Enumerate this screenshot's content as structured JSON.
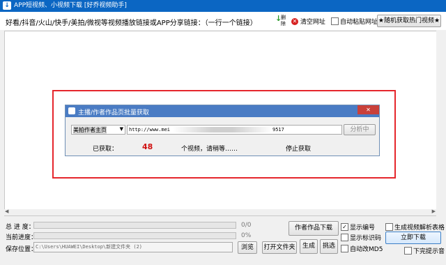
{
  "window": {
    "title": "APP短视频、小视频下载 [好乔视频助手]"
  },
  "top": {
    "prompt": "好看/抖音/火山/快手/美拍/微视等视频播放链接或APP分享链接：（一行一个链接）",
    "dl_icon": "↓",
    "dl_label1": "删",
    "dl_label2": "除",
    "clear_label": "清空网址",
    "auto_paste_label": "自动粘贴网址",
    "random_button": "★随机获取热门视频★"
  },
  "dialog": {
    "title": "主播/作者作品页批量获取",
    "close_label": "✕",
    "select_value": "美拍作者主页",
    "url_start": "http://www.mei",
    "url_end": "9517",
    "analyze_button": "分析中",
    "got_label": "已获取：",
    "count": "48",
    "status": "个视频，请稍等……",
    "stop_label": "停止获取"
  },
  "bottom": {
    "total_progress_label": "总 进 度：",
    "total_progress_value": "0/0",
    "current_progress_label": "当前进度：",
    "current_progress_value": "0%",
    "save_label": "保存位置：",
    "save_path": "C:\\Users\\HUAWEI\\Desktop\\新建文件夹 (2)",
    "browse_button": "浏览",
    "open_folder_button": "打开文件夹",
    "generate_button": "生成",
    "pick_button": "挑选",
    "author_download_button": "作者作品下载",
    "show_number_label": "显示编号",
    "show_tag_label": "显示标识码",
    "auto_md5_label": "自动改MD5",
    "parse_table_label": "生成视频解析表格",
    "download_now_button": "立即下载",
    "tip_label": "下完提示音",
    "show_number_checked": "✓"
  },
  "colors": {
    "accent": "#0b66c3",
    "highlight": "#e5262c",
    "count_color": "#d01010"
  }
}
